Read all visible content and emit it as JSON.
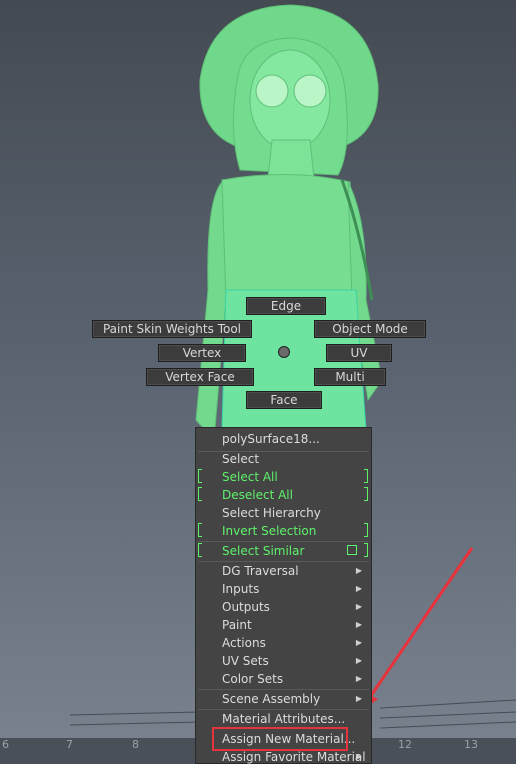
{
  "marking_menu": {
    "edge": "Edge",
    "paint_skin": "Paint Skin Weights Tool",
    "object_mode": "Object Mode",
    "vertex": "Vertex",
    "uv": "UV",
    "vertex_face": "Vertex Face",
    "multi": "Multi",
    "face": "Face"
  },
  "context_menu": {
    "title": "polySurface18...",
    "items": [
      {
        "label": "Select"
      },
      {
        "label": "Select All"
      },
      {
        "label": "Deselect All"
      },
      {
        "label": "Select Hierarchy"
      },
      {
        "label": "Invert Selection"
      },
      {
        "label": "Select Similar"
      },
      {
        "label": "DG Traversal"
      },
      {
        "label": "Inputs"
      },
      {
        "label": "Outputs"
      },
      {
        "label": "Paint"
      },
      {
        "label": "Actions"
      },
      {
        "label": "UV Sets"
      },
      {
        "label": "Color Sets"
      },
      {
        "label": "Scene Assembly"
      },
      {
        "label": "Material Attributes..."
      },
      {
        "label": "Assign New Material..."
      },
      {
        "label": "Assign Favorite Material"
      }
    ]
  },
  "grid": {
    "ticks": [
      "6",
      "7",
      "8",
      "12",
      "13"
    ]
  },
  "colors": {
    "selection_green": "#5ef26b",
    "annotation_red": "#e8323c",
    "menu_bg": "#444444"
  }
}
